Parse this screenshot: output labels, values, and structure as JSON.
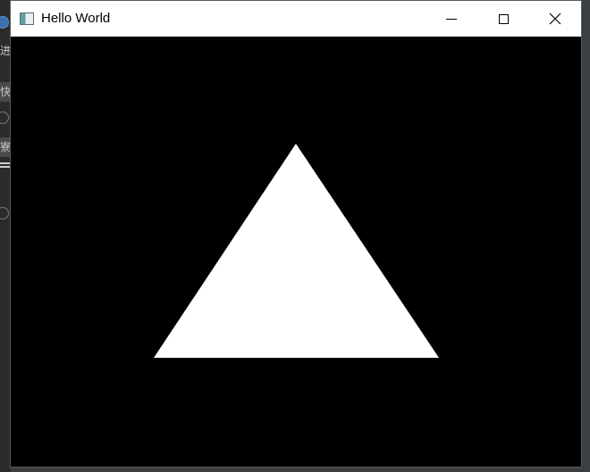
{
  "background_app": {
    "side_glyphs": [
      "进",
      "快",
      "寮"
    ]
  },
  "window": {
    "title": "Hello World",
    "icon": "app-window-icon",
    "controls": {
      "minimize": "minimize-icon",
      "maximize": "maximize-icon",
      "close": "close-icon"
    }
  },
  "scene": {
    "background_color": "#000000",
    "shape": "triangle",
    "shape_color": "#ffffff"
  }
}
